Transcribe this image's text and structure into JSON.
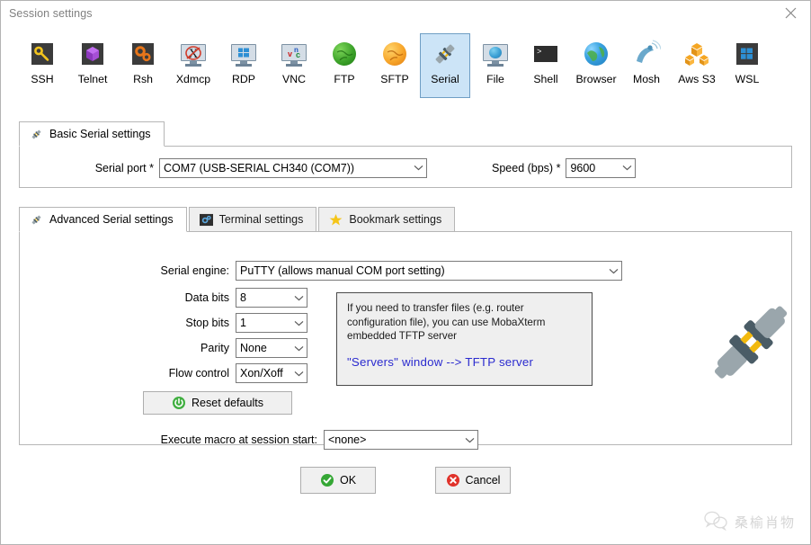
{
  "window": {
    "title": "Session settings",
    "close_label": "×"
  },
  "session_types": [
    {
      "label": "SSH",
      "icon": "ssh-key-icon",
      "selected": false
    },
    {
      "label": "Telnet",
      "icon": "telnet-cube-icon",
      "selected": false
    },
    {
      "label": "Rsh",
      "icon": "rsh-gears-icon",
      "selected": false
    },
    {
      "label": "Xdmcp",
      "icon": "xdmcp-monitor-icon",
      "selected": false
    },
    {
      "label": "RDP",
      "icon": "rdp-monitor-icon",
      "selected": false
    },
    {
      "label": "VNC",
      "icon": "vnc-monitor-icon",
      "selected": false
    },
    {
      "label": "FTP",
      "icon": "ftp-globe-icon",
      "selected": false
    },
    {
      "label": "SFTP",
      "icon": "sftp-globe-icon",
      "selected": false
    },
    {
      "label": "Serial",
      "icon": "serial-plug-icon",
      "selected": true
    },
    {
      "label": "File",
      "icon": "file-monitor-icon",
      "selected": false
    },
    {
      "label": "Shell",
      "icon": "shell-console-icon",
      "selected": false
    },
    {
      "label": "Browser",
      "icon": "browser-globe-icon",
      "selected": false
    },
    {
      "label": "Mosh",
      "icon": "mosh-satellite-icon",
      "selected": false
    },
    {
      "label": "Aws S3",
      "icon": "aws-s3-cubes-icon",
      "selected": false
    },
    {
      "label": "WSL",
      "icon": "wsl-windows-icon",
      "selected": false
    }
  ],
  "basic": {
    "tab_label": "Basic Serial settings",
    "tab_icon": "serial-plug-icon",
    "serial_port_label": "Serial port *",
    "serial_port_value": "COM7   (USB-SERIAL CH340 (COM7))",
    "speed_label": "Speed (bps) *",
    "speed_value": "9600"
  },
  "lower_tabs": [
    {
      "label": "Advanced Serial settings",
      "icon": "serial-plug-icon",
      "active": true
    },
    {
      "label": "Terminal settings",
      "icon": "terminal-gear-icon",
      "active": false
    },
    {
      "label": "Bookmark settings",
      "icon": "bookmark-star-icon",
      "active": false
    }
  ],
  "advanced": {
    "serial_engine_label": "Serial engine:",
    "serial_engine_value": "PuTTY    (allows manual COM port setting)",
    "data_bits_label": "Data bits",
    "data_bits_value": "8",
    "stop_bits_label": "Stop bits",
    "stop_bits_value": "1",
    "parity_label": "Parity",
    "parity_value": "None",
    "flow_control_label": "Flow control",
    "flow_control_value": "Xon/Xoff",
    "reset_defaults_label": "Reset defaults",
    "reset_icon": "reset-power-icon",
    "macro_label": "Execute macro at session start:",
    "macro_value": "<none>",
    "info_text": "If you need to transfer files (e.g. router configuration file), you can use MobaXterm embedded TFTP server",
    "info_link": "\"Servers\" window  -->  TFTP server",
    "illustration_icon": "serial-plug-large-icon"
  },
  "footer": {
    "ok_label": "OK",
    "ok_icon": "check-circle-icon",
    "cancel_label": "Cancel",
    "cancel_icon": "error-circle-icon"
  },
  "watermark": {
    "icon": "wechat-icon",
    "text": "桑榆肖物"
  },
  "colors": {
    "selection_fill": "#cce4f7",
    "selection_border": "#6f9ec4",
    "link_blue": "#2b2bcf",
    "ok_green": "#35a735",
    "cancel_red": "#e0322a",
    "panel_border": "#b6b6b6"
  }
}
